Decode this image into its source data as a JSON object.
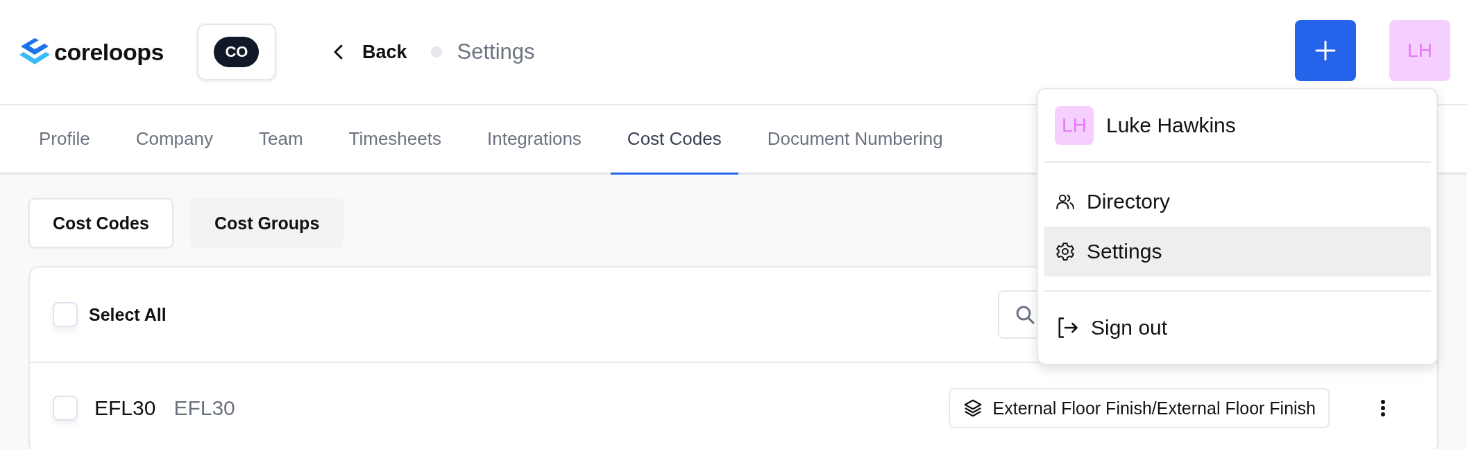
{
  "header": {
    "logo": "coreloops",
    "company_badge": "CO",
    "back": "Back",
    "current_page": "Settings",
    "avatar": "LH"
  },
  "tabs": [
    {
      "label": "Profile",
      "selected": false
    },
    {
      "label": "Company",
      "selected": false
    },
    {
      "label": "Team",
      "selected": false
    },
    {
      "label": "Timesheets",
      "selected": false
    },
    {
      "label": "Integrations",
      "selected": false
    },
    {
      "label": "Cost Codes",
      "selected": true
    },
    {
      "label": "Document Numbering",
      "selected": false
    }
  ],
  "segments": [
    {
      "label": "Cost Codes",
      "selected": true
    },
    {
      "label": "Cost Groups",
      "selected": false
    }
  ],
  "select_all": {
    "label": "Select All",
    "checked": false
  },
  "rows": [
    {
      "code": "EFL30",
      "name": "EFL30",
      "checked": false,
      "group": "External Floor Finish/External Floor Finish"
    }
  ],
  "user_menu": {
    "avatar": "LH",
    "name": "Luke Hawkins",
    "sections": [
      [
        {
          "label": "Directory",
          "kind": "directory",
          "selected": false
        },
        {
          "label": "Settings",
          "kind": "settings",
          "selected": true
        }
      ],
      [
        {
          "label": "Sign out",
          "kind": "sign-out",
          "selected": false
        }
      ]
    ]
  }
}
